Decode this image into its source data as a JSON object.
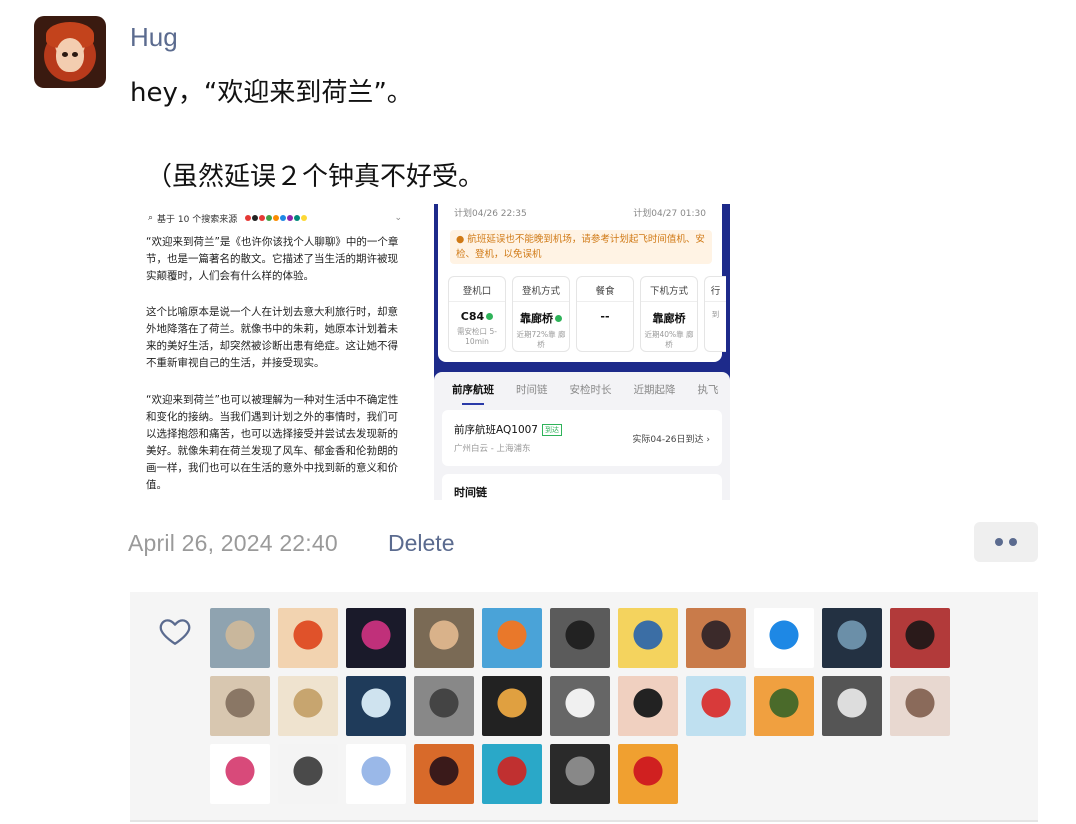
{
  "post": {
    "author": "Hug",
    "line1": "hey，“欢迎来到荷兰”。",
    "line2": "（虽然延误２个钟真不好受。",
    "timestamp": "April 26, 2024 22:40",
    "delete_label": "Delete"
  },
  "attachment": {
    "left": {
      "source_text": "基于 10 个搜索来源",
      "para1": "“欢迎来到荷兰”是《也许你该找个人聊聊》中的一个章节，也是一篇著名的散文。它描述了当生活的期许被现实颠覆时，人们会有什么样的体验。",
      "para2": "这个比喻原本是说一个人在计划去意大利旅行时，却意外地降落在了荷兰。就像书中的朱莉，她原本计划着未来的美好生活，却突然被诊断出患有绝症。这让她不得不重新审视自己的生活，并接受现实。",
      "para3": "“欢迎来到荷兰”也可以被理解为一种对生活中不确定性和变化的接纳。当我们遇到计划之外的事情时，我们可以选择抱怨和痛苦，也可以选择接受并尝试去发现新的美好。就像朱莉在荷兰发现了风车、郁金香和伦勃朗的画一样，我们也可以在生活的意外中找到新的意义和价值。"
    },
    "right": {
      "plan_left": "计划04/26 22:35",
      "plan_right": "计划04/27 01:30",
      "warning": "航班延误也不能晚到机场，请参考计划起飞时间值机、安检、登机，以免误机",
      "tiles": [
        {
          "header": "登机口",
          "value": "C84",
          "sub": "需安检口 5-10min"
        },
        {
          "header": "登机方式",
          "value": "靠廊桥",
          "sub": "近期72%靠 廊桥"
        },
        {
          "header": "餐食",
          "value": "--",
          "sub": ""
        },
        {
          "header": "下机方式",
          "value": "靠廊桥",
          "sub": "近期40%靠 廊桥"
        },
        {
          "header": "行",
          "value": "",
          "sub": "到"
        }
      ],
      "tabs": [
        "前序航班",
        "时间链",
        "安检时长",
        "近期起降",
        "执飞"
      ],
      "flight_title": "前序航班AQ1007",
      "flight_badge": "到达",
      "flight_route": "广州白云 - 上海浦东",
      "flight_actual": "实际04-26日到达 ›",
      "chain_title": "时间链"
    }
  },
  "likes": {
    "icon": "heart-outline-icon",
    "count_visible": 29
  },
  "colors": {
    "link": "#5b6b8f",
    "timestamp": "#9a9a9a",
    "panel_bg": "#f5f5f5",
    "flight_app_blue": "#1d2a8a"
  }
}
